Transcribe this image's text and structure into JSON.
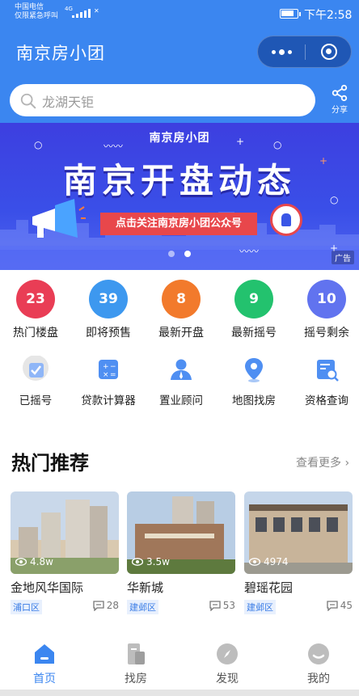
{
  "status_bar": {
    "carrier_line1": "中国电信",
    "carrier_line2": "仅限紧急呼叫",
    "network": "4G",
    "time": "下午2:58"
  },
  "nav": {
    "title": "南京房小团"
  },
  "search": {
    "placeholder": "龙湖天钜"
  },
  "share": {
    "label": "分享"
  },
  "banner": {
    "subtitle": "南京房小团",
    "title": "南京开盘动态",
    "cta": "点击关注南京房小团公众号",
    "ad_label": "广告",
    "dots": 2,
    "active_dot": 1
  },
  "counters": [
    {
      "value": "23",
      "label": "热门楼盘",
      "color": "#e93d55"
    },
    {
      "value": "39",
      "label": "即将预售",
      "color": "#3d98ef"
    },
    {
      "value": "8",
      "label": "最新开盘",
      "color": "#f27a2c"
    },
    {
      "value": "9",
      "label": "最新摇号",
      "color": "#23c26e"
    },
    {
      "value": "10",
      "label": "摇号剩余",
      "color": "#6173ef"
    }
  ],
  "tools": [
    {
      "label": "已摇号",
      "icon": "check-badge-icon"
    },
    {
      "label": "贷款计算器",
      "icon": "calculator-icon"
    },
    {
      "label": "置业顾问",
      "icon": "consultant-icon"
    },
    {
      "label": "地图找房",
      "icon": "map-pin-icon"
    },
    {
      "label": "资格查询",
      "icon": "search-document-icon"
    }
  ],
  "section": {
    "title": "热门推荐",
    "see_more": "查看更多"
  },
  "cards": [
    {
      "name": "金地风华国际",
      "views": "4.8w",
      "district": "浦口区",
      "comments": "28"
    },
    {
      "name": "华新城",
      "views": "3.5w",
      "district": "建邺区",
      "comments": "53"
    },
    {
      "name": "碧瑶花园",
      "views": "4974",
      "district": "建邺区",
      "comments": "45"
    }
  ],
  "tabbar": [
    {
      "label": "首页",
      "icon": "home-icon",
      "active": true
    },
    {
      "label": "找房",
      "icon": "find-house-icon",
      "active": false
    },
    {
      "label": "发现",
      "icon": "compass-icon",
      "active": false
    },
    {
      "label": "我的",
      "icon": "profile-icon",
      "active": false
    }
  ],
  "colors": {
    "primary": "#3b86f0",
    "banner": "#3d3fe0",
    "cta": "#e8474b"
  }
}
